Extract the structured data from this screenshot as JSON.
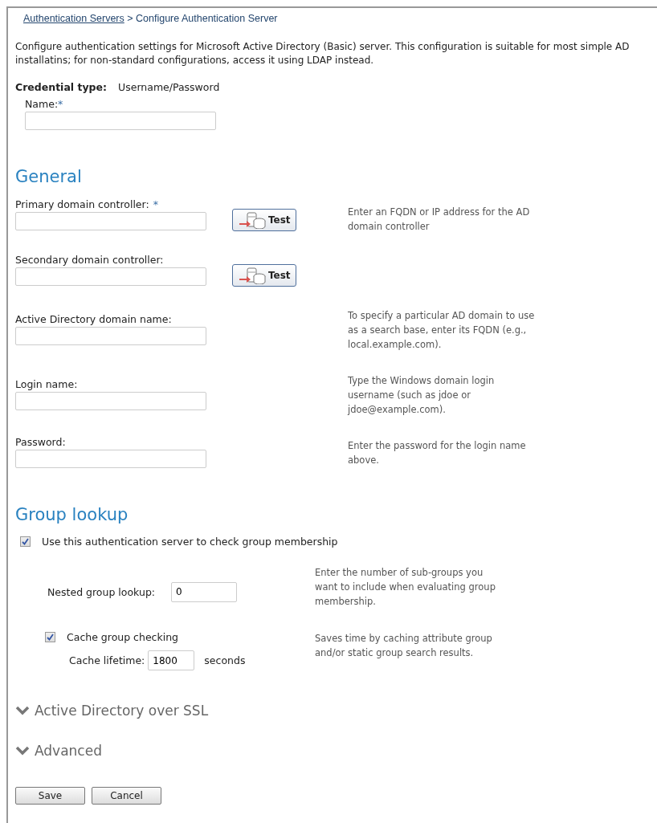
{
  "breadcrumb": {
    "link": "Authentication Servers",
    "separator": ">",
    "current": "Configure Authentication Server"
  },
  "description": "Configure authentication settings for Microsoft Active Directory (Basic) server. This configuration is suitable for most simple AD installatins; for non-standard configurations, access it using LDAP instead.",
  "credential_type": {
    "label": "Credential type:",
    "value": "Username/Password"
  },
  "name_field": {
    "label": "Name:",
    "required_mark": "*"
  },
  "general": {
    "title": "General",
    "fields": [
      {
        "label": "Primary domain controller:",
        "required_mark": "*",
        "button": "Test",
        "help": "Enter an FQDN or IP address for the AD domain controller"
      },
      {
        "label": "Secondary domain controller:",
        "button": "Test"
      },
      {
        "label": "Active Directory domain name:",
        "help": "To specify a particular AD domain to use as a search base, enter its FQDN (e.g., local.example.com)."
      },
      {
        "label": "Login name:",
        "help": "Type the Windows domain login username (such as jdoe or jdoe@example.com)."
      },
      {
        "label": "Password:",
        "help": "Enter the password for the login name above."
      }
    ]
  },
  "group_lookup": {
    "title": "Group lookup",
    "use_server": {
      "label": "Use this authentication server to check group membership",
      "checked": true
    },
    "nested": {
      "label": "Nested group lookup:",
      "value": "0",
      "help": "Enter the number of sub-groups you want to include when evaluating group membership."
    },
    "cache": {
      "label": "Cache group checking",
      "checked": true,
      "lifetime_label": "Cache lifetime:",
      "value": "1800",
      "unit": "seconds",
      "help": "Saves time by caching attribute group and/or static group search results."
    }
  },
  "collapsibles": [
    {
      "title": "Active Directory over SSL",
      "expanded": false
    },
    {
      "title": "Advanced",
      "expanded": false
    }
  ],
  "buttons": [
    "Save",
    "Cancel"
  ]
}
